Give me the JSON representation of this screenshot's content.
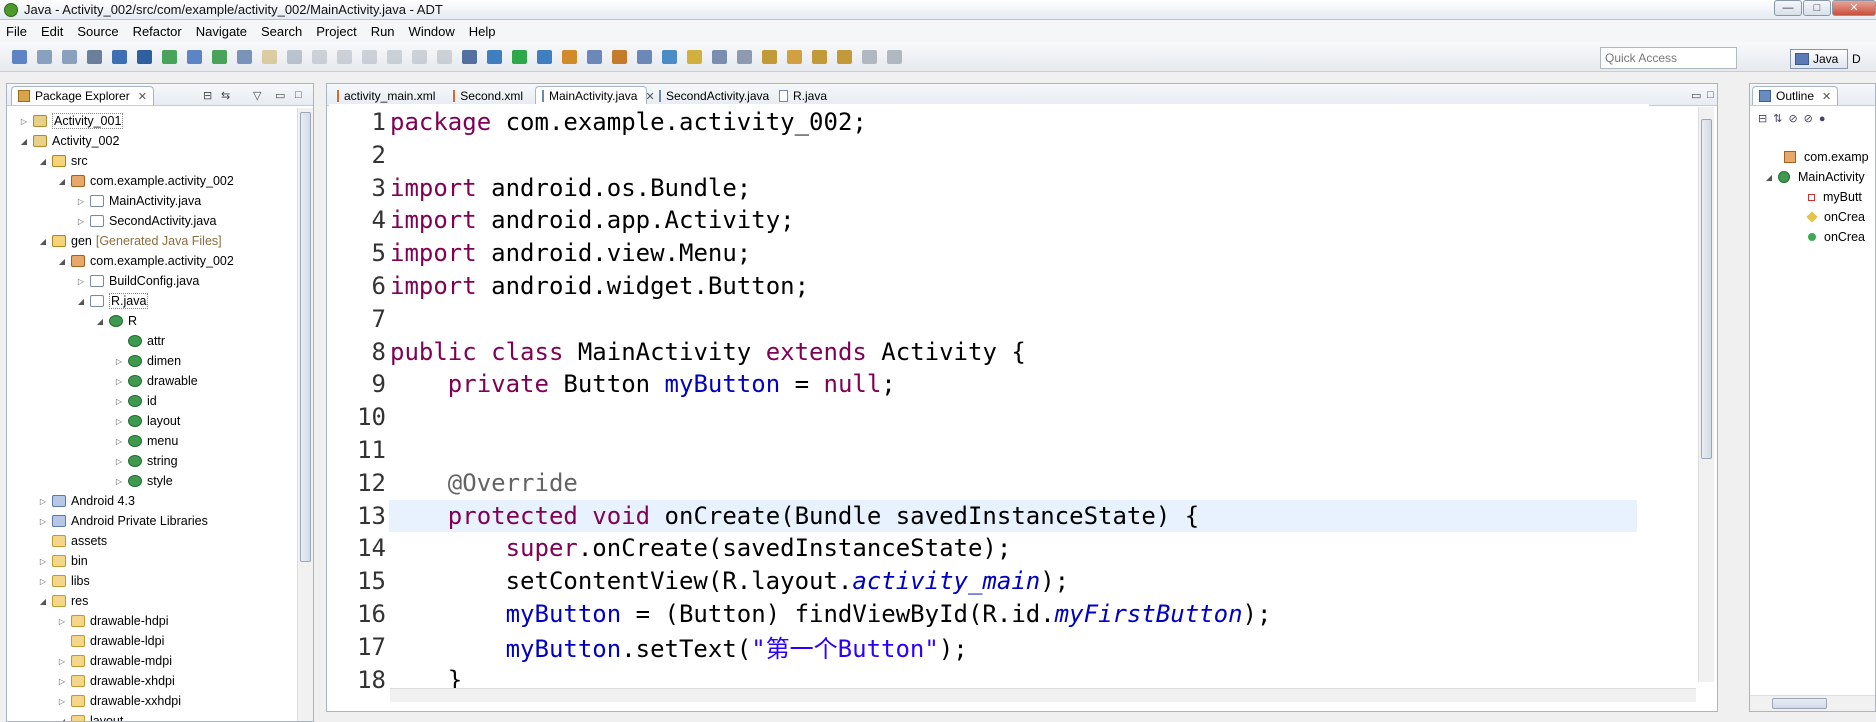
{
  "window": {
    "title": "Java - Activity_002/src/com/example/activity_002/MainActivity.java - ADT"
  },
  "menu": [
    "File",
    "Edit",
    "Source",
    "Refactor",
    "Navigate",
    "Search",
    "Project",
    "Run",
    "Window",
    "Help"
  ],
  "toolbar": {
    "quick_access_placeholder": "Quick Access",
    "perspective_label": "Java",
    "perspective2_label": "D"
  },
  "package_explorer": {
    "title": "Package Explorer",
    "tree": [
      {
        "label": "Activity_001",
        "icon": "project-icon",
        "depth": 0,
        "twisty": "collapsed"
      },
      {
        "label": "Activity_002",
        "icon": "project-icon",
        "depth": 0,
        "twisty": "expanded"
      },
      {
        "label": "src",
        "icon": "source-folder-icon",
        "depth": 1,
        "twisty": "expanded"
      },
      {
        "label": "com.example.activity_002",
        "icon": "package-icon",
        "depth": 2,
        "twisty": "expanded"
      },
      {
        "label": "MainActivity.java",
        "icon": "java-file-icon",
        "depth": 3,
        "twisty": "collapsed"
      },
      {
        "label": "SecondActivity.java",
        "icon": "java-file-icon",
        "depth": 3,
        "twisty": "collapsed"
      },
      {
        "label": "gen",
        "suffix": "[Generated Java Files]",
        "icon": "source-folder-icon",
        "depth": 1,
        "twisty": "expanded"
      },
      {
        "label": "com.example.activity_002",
        "icon": "package-icon",
        "depth": 2,
        "twisty": "expanded"
      },
      {
        "label": "BuildConfig.java",
        "icon": "java-file-icon",
        "depth": 3,
        "twisty": "collapsed"
      },
      {
        "label": "R.java",
        "icon": "java-file-icon",
        "depth": 3,
        "twisty": "expanded"
      },
      {
        "label": "R",
        "icon": "class-icon",
        "depth": 4,
        "twisty": "expanded"
      },
      {
        "label": "attr",
        "icon": "class-icon",
        "depth": 5,
        "twisty": "none"
      },
      {
        "label": "dimen",
        "icon": "class-icon",
        "depth": 5,
        "twisty": "collapsed"
      },
      {
        "label": "drawable",
        "icon": "class-icon",
        "depth": 5,
        "twisty": "collapsed"
      },
      {
        "label": "id",
        "icon": "class-icon",
        "depth": 5,
        "twisty": "collapsed"
      },
      {
        "label": "layout",
        "icon": "class-icon",
        "depth": 5,
        "twisty": "collapsed"
      },
      {
        "label": "menu",
        "icon": "class-icon",
        "depth": 5,
        "twisty": "collapsed"
      },
      {
        "label": "string",
        "icon": "class-icon",
        "depth": 5,
        "twisty": "collapsed"
      },
      {
        "label": "style",
        "icon": "class-icon",
        "depth": 5,
        "twisty": "collapsed"
      },
      {
        "label": "Android 4.3",
        "icon": "library-icon",
        "depth": 1,
        "twisty": "collapsed"
      },
      {
        "label": "Android Private Libraries",
        "icon": "library-icon",
        "depth": 1,
        "twisty": "collapsed"
      },
      {
        "label": "assets",
        "icon": "folder-icon",
        "depth": 1,
        "twisty": "none"
      },
      {
        "label": "bin",
        "icon": "folder-icon",
        "depth": 1,
        "twisty": "collapsed"
      },
      {
        "label": "libs",
        "icon": "folder-icon",
        "depth": 1,
        "twisty": "collapsed"
      },
      {
        "label": "res",
        "icon": "folder-icon",
        "depth": 1,
        "twisty": "expanded"
      },
      {
        "label": "drawable-hdpi",
        "icon": "folder-icon",
        "depth": 2,
        "twisty": "collapsed"
      },
      {
        "label": "drawable-ldpi",
        "icon": "folder-icon",
        "depth": 2,
        "twisty": "none"
      },
      {
        "label": "drawable-mdpi",
        "icon": "folder-icon",
        "depth": 2,
        "twisty": "collapsed"
      },
      {
        "label": "drawable-xhdpi",
        "icon": "folder-icon",
        "depth": 2,
        "twisty": "collapsed"
      },
      {
        "label": "drawable-xxhdpi",
        "icon": "folder-icon",
        "depth": 2,
        "twisty": "collapsed"
      },
      {
        "label": "layout",
        "icon": "folder-icon",
        "depth": 2,
        "twisty": "expanded"
      }
    ]
  },
  "editor": {
    "tabs": [
      {
        "label": "activity_main.xml",
        "active": false
      },
      {
        "label": "Second.xml",
        "active": false
      },
      {
        "label": "MainActivity.java",
        "active": true
      },
      {
        "label": "SecondActivity.java",
        "active": false
      },
      {
        "label": "R.java",
        "active": false
      }
    ],
    "current_line": 13,
    "lines": [
      {
        "n": "1",
        "tokens": [
          [
            "kw",
            "package"
          ],
          [
            "",
            "com.example.activity_002;"
          ]
        ]
      },
      {
        "n": "2",
        "tokens": []
      },
      {
        "n": "3",
        "tokens": [
          [
            "kw",
            "import"
          ],
          [
            "",
            " android.os.Bundle;"
          ]
        ]
      },
      {
        "n": "4",
        "tokens": [
          [
            "kw",
            "import"
          ],
          [
            "",
            " android.app.Activity;"
          ]
        ]
      },
      {
        "n": "5",
        "tokens": [
          [
            "kw",
            "import"
          ],
          [
            "",
            " android.view.Menu;"
          ]
        ]
      },
      {
        "n": "6",
        "tokens": [
          [
            "kw",
            "import"
          ],
          [
            "",
            " android.widget.Button;"
          ]
        ]
      },
      {
        "n": "7",
        "tokens": []
      },
      {
        "n": "8",
        "tokens": [
          [
            "kw",
            "public"
          ],
          [
            "",
            " "
          ],
          [
            "kw",
            "class"
          ],
          [
            "",
            " MainActivity "
          ],
          [
            "kw",
            "extends"
          ],
          [
            "",
            " Activity {"
          ]
        ]
      },
      {
        "n": "9",
        "tokens": [
          [
            "",
            "    "
          ],
          [
            "kw",
            "private"
          ],
          [
            "",
            " Button "
          ],
          [
            "fld",
            "myButton"
          ],
          [
            "",
            " = "
          ],
          [
            "kw",
            "null"
          ],
          [
            "",
            ";"
          ]
        ]
      },
      {
        "n": "10",
        "tokens": []
      },
      {
        "n": "11",
        "tokens": []
      },
      {
        "n": "12",
        "tokens": [
          [
            "",
            "    "
          ],
          [
            "ann",
            "@Override"
          ]
        ]
      },
      {
        "n": "13",
        "tokens": [
          [
            "",
            "    "
          ],
          [
            "kw",
            "protected"
          ],
          [
            "",
            " "
          ],
          [
            "kw",
            "void"
          ],
          [
            "",
            " onCreate(Bundle savedInstanceState) {"
          ]
        ]
      },
      {
        "n": "14",
        "tokens": [
          [
            "",
            "        "
          ],
          [
            "kw",
            "super"
          ],
          [
            "",
            ".onCreate(savedInstanceState);"
          ]
        ]
      },
      {
        "n": "15",
        "tokens": [
          [
            "",
            "        setContentView(R.layout."
          ],
          [
            "sfld",
            "activity_main"
          ],
          [
            "",
            ");"
          ]
        ]
      },
      {
        "n": "16",
        "tokens": [
          [
            "",
            "        "
          ],
          [
            "fld",
            "myButton"
          ],
          [
            "",
            " = (Button) findViewById(R.id."
          ],
          [
            "sfld",
            "myFirstButton"
          ],
          [
            "",
            ");"
          ]
        ]
      },
      {
        "n": "17",
        "tokens": [
          [
            "",
            "        "
          ],
          [
            "fld",
            "myButton"
          ],
          [
            "",
            ".setText("
          ],
          [
            "str",
            "\"第一个Button\""
          ],
          [
            "",
            ");"
          ]
        ]
      },
      {
        "n": "18",
        "tokens": [
          [
            "",
            "    }"
          ]
        ]
      }
    ]
  },
  "outline": {
    "title": "Outline",
    "items": [
      {
        "label": "com.examp",
        "icon": "package-icon"
      },
      {
        "label": "MainActivity",
        "icon": "class-icon"
      },
      {
        "label": "myButt",
        "icon": "private-field-icon"
      },
      {
        "label": "onCrea",
        "icon": "protected-method-icon"
      },
      {
        "label": "onCrea",
        "icon": "public-method-icon"
      }
    ]
  }
}
